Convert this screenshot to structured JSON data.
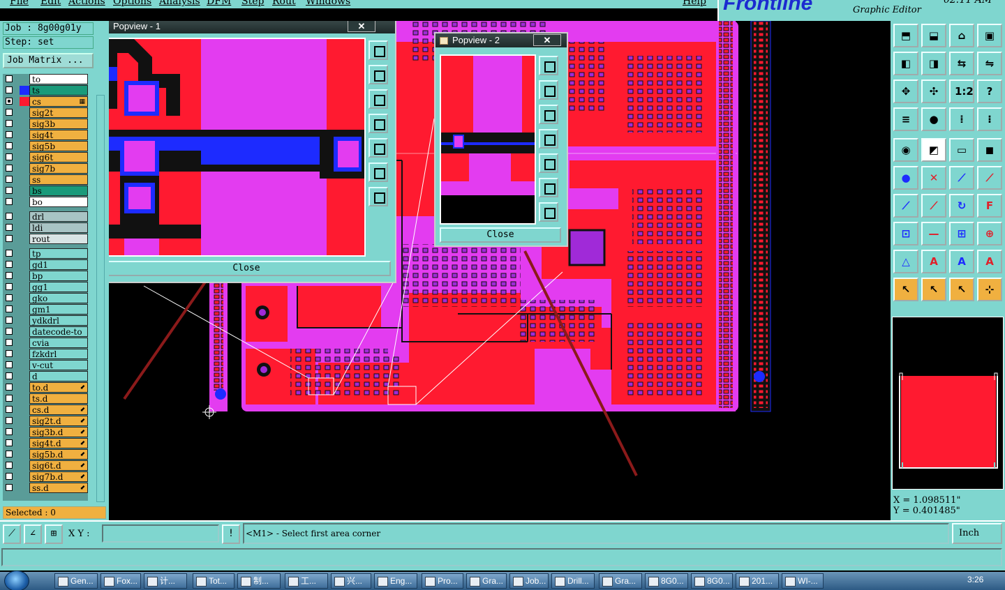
{
  "menu": [
    "File",
    "Edit",
    "Actions",
    "Options",
    "Analysis",
    "DFM",
    "Step",
    "Rout",
    "Windows",
    "Help"
  ],
  "brand": {
    "logo": "Frontline",
    "subtitle": "Graphic Editor",
    "clock": "02:11 AM"
  },
  "job": {
    "job_label": "Job : 8g00g01y",
    "step_label": "Step: set",
    "matrix_button": "Job Matrix ..."
  },
  "layers": [
    {
      "name": "to",
      "color": "#ffffff",
      "swatch": "",
      "checked": false
    },
    {
      "name": "ts",
      "color": "#1a9a7a",
      "swatch": "#1d2bff",
      "checked": false
    },
    {
      "name": "cs",
      "color": "#f0b040",
      "swatch": "#ff1a30",
      "checked": true,
      "mark": "▦"
    },
    {
      "name": "sig2t",
      "color": "#f0b040",
      "swatch": "",
      "checked": false
    },
    {
      "name": "sig3b",
      "color": "#f0b040",
      "swatch": "",
      "checked": false
    },
    {
      "name": "sig4t",
      "color": "#f0b040",
      "swatch": "",
      "checked": false
    },
    {
      "name": "sig5b",
      "color": "#f0b040",
      "swatch": "",
      "checked": false
    },
    {
      "name": "sig6t",
      "color": "#f0b040",
      "swatch": "",
      "checked": false
    },
    {
      "name": "sig7b",
      "color": "#f0b040",
      "swatch": "",
      "checked": false
    },
    {
      "name": "ss",
      "color": "#f0b040",
      "swatch": "",
      "checked": false
    },
    {
      "name": "bs",
      "color": "#1a9a7a",
      "swatch": "",
      "checked": false
    },
    {
      "name": "bo",
      "color": "#ffffff",
      "swatch": "",
      "checked": false
    },
    {
      "name": "drl",
      "color": "#a8c4c4",
      "swatch": "",
      "checked": false,
      "gap": true
    },
    {
      "name": "ldi",
      "color": "#a8c4c4",
      "swatch": "",
      "checked": false
    },
    {
      "name": "rout",
      "color": "#d8e4e4",
      "swatch": "",
      "checked": false
    },
    {
      "name": "tp",
      "color": "#7fd6cf",
      "swatch": "",
      "checked": false,
      "gap": true
    },
    {
      "name": "gd1",
      "color": "#7fd6cf",
      "swatch": "",
      "checked": false
    },
    {
      "name": "bp",
      "color": "#7fd6cf",
      "swatch": "",
      "checked": false
    },
    {
      "name": "gg1",
      "color": "#7fd6cf",
      "swatch": "",
      "checked": false
    },
    {
      "name": "gko",
      "color": "#7fd6cf",
      "swatch": "",
      "checked": false
    },
    {
      "name": "gm1",
      "color": "#7fd6cf",
      "swatch": "",
      "checked": false
    },
    {
      "name": "ydkdrl",
      "color": "#7fd6cf",
      "swatch": "",
      "checked": false
    },
    {
      "name": "datecode-to",
      "color": "#7fd6cf",
      "swatch": "",
      "checked": false
    },
    {
      "name": "cvia",
      "color": "#7fd6cf",
      "swatch": "",
      "checked": false
    },
    {
      "name": "fzkdrl",
      "color": "#7fd6cf",
      "swatch": "",
      "checked": false
    },
    {
      "name": "v-cut",
      "color": "#7fd6cf",
      "swatch": "",
      "checked": false
    },
    {
      "name": "d",
      "color": "#7fd6cf",
      "swatch": "",
      "checked": false
    },
    {
      "name": "to.d",
      "color": "#f0b040",
      "swatch": "",
      "checked": false,
      "mark": "⬋"
    },
    {
      "name": "ts.d",
      "color": "#f0b040",
      "swatch": "",
      "checked": false
    },
    {
      "name": "cs.d",
      "color": "#f0b040",
      "swatch": "",
      "checked": false,
      "mark": "⬋"
    },
    {
      "name": "sig2t.d",
      "color": "#f0b040",
      "swatch": "",
      "checked": false,
      "mark": "⬋"
    },
    {
      "name": "sig3b.d",
      "color": "#f0b040",
      "swatch": "",
      "checked": false,
      "mark": "⬋"
    },
    {
      "name": "sig4t.d",
      "color": "#f0b040",
      "swatch": "",
      "checked": false,
      "mark": "⬋"
    },
    {
      "name": "sig5b.d",
      "color": "#f0b040",
      "swatch": "",
      "checked": false,
      "mark": "⬋"
    },
    {
      "name": "sig6t.d",
      "color": "#f0b040",
      "swatch": "",
      "checked": false,
      "mark": "⬋"
    },
    {
      "name": "sig7b.d",
      "color": "#f0b040",
      "swatch": "",
      "checked": false,
      "mark": "⬋"
    },
    {
      "name": "ss.d",
      "color": "#f0b040",
      "swatch": "",
      "checked": false,
      "mark": "⬋"
    }
  ],
  "selected_label": "Selected : 0",
  "popview1": {
    "title": "Popview - 1",
    "close": "Close"
  },
  "popview2": {
    "title": "Popview - 2",
    "close": "Close"
  },
  "palette": {
    "row_glyphs": [
      [
        "⬒",
        "⬓",
        "⌂",
        "▣"
      ],
      [
        "◧",
        "◨",
        "⇆",
        "⇋"
      ],
      [
        "✥",
        "✣",
        "1:2",
        "?"
      ],
      [
        "≡",
        "●",
        "⁞",
        "⁝"
      ],
      [
        "◉",
        "◩",
        "▭",
        "◼"
      ],
      [
        "●",
        "✕",
        "⟋",
        "⟋"
      ],
      [
        "⟋",
        "⟋",
        "↻",
        "F"
      ],
      [
        "⊡",
        "—",
        "⊞",
        "⊕"
      ],
      [
        "△",
        "A",
        "A",
        "A"
      ],
      [
        "↖",
        "↖",
        "↖",
        "⊹"
      ]
    ]
  },
  "coords": {
    "x": "X = 1.098511\"",
    "y": "Y = 0.401485\""
  },
  "command": {
    "xy_label": "X Y :",
    "xy_value": "",
    "prompt": "<M1> - Select first area corner",
    "units": "Inch"
  },
  "taskbar": {
    "items": [
      "Gen...",
      "Fox...",
      "计...",
      "Tot...",
      "制...",
      "工...",
      "兴...",
      "Eng...",
      "Pro...",
      "Gra...",
      "Job...",
      "Drill...",
      "Gra...",
      "8G0...",
      "8G0...",
      "201...",
      "WI-..."
    ],
    "clock": "3:26"
  },
  "colors": {
    "panel": "#7fd6cf",
    "board_red": "#ff1a30",
    "board_magenta": "#e33cf0",
    "trace_blue": "#1d2bff",
    "accent": "#f0b040"
  }
}
